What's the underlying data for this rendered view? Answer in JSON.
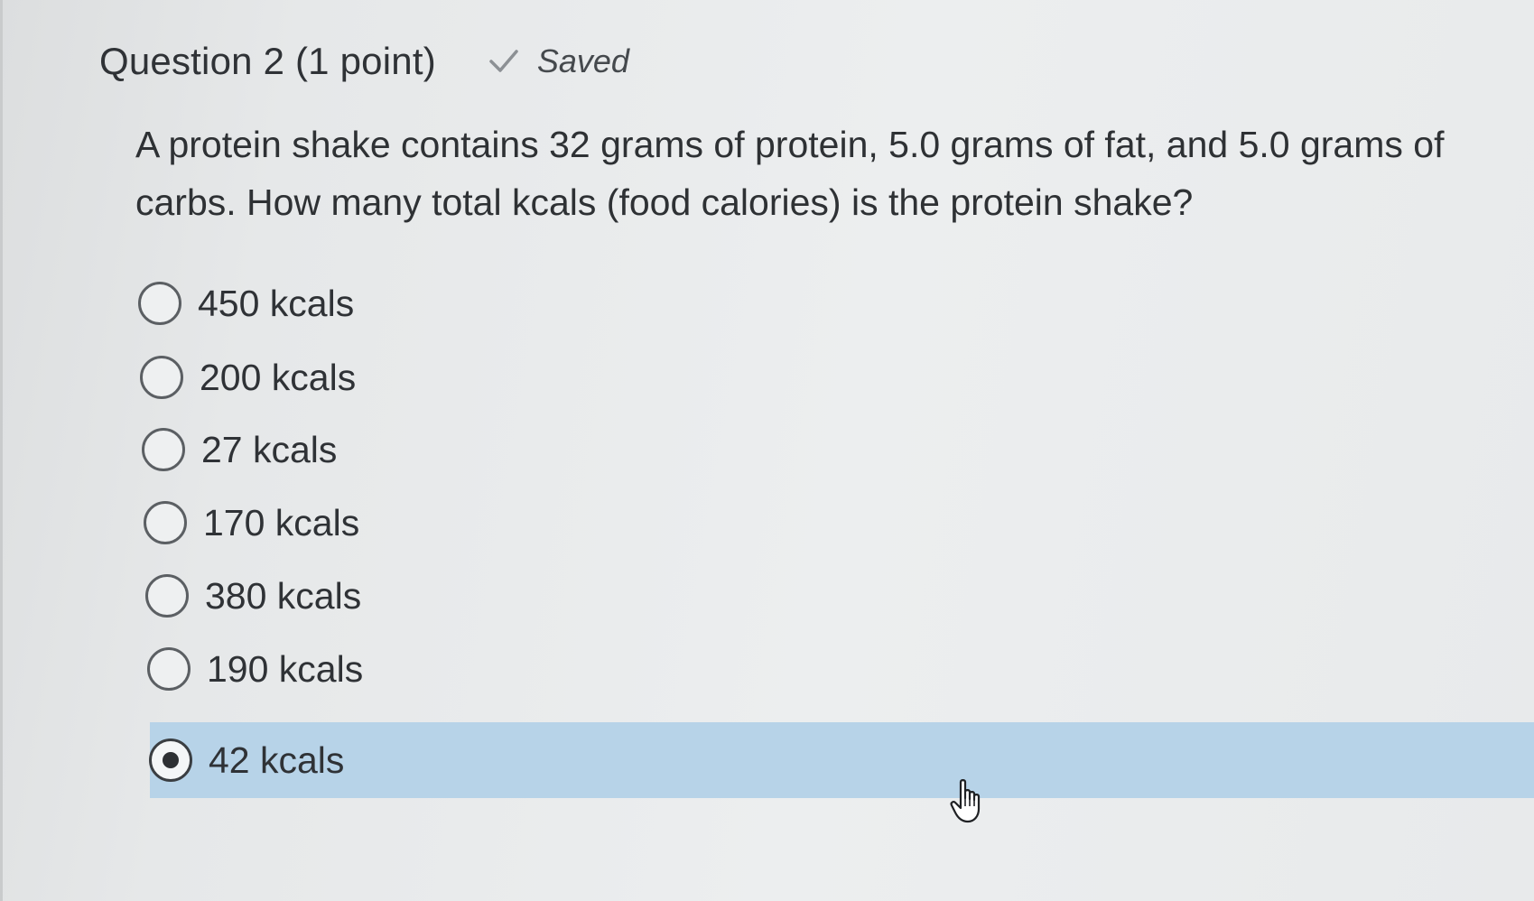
{
  "question": {
    "title": "Question 2 (1 point)",
    "status": "Saved",
    "text": "A protein shake contains 32 grams of protein, 5.0 grams of fat, and 5.0 grams of carbs. How many total kcals (food calories) is the protein shake?"
  },
  "options": [
    {
      "label": "450 kcals",
      "selected": false
    },
    {
      "label": "200 kcals",
      "selected": false
    },
    {
      "label": "27 kcals",
      "selected": false
    },
    {
      "label": "170 kcals",
      "selected": false
    },
    {
      "label": "380 kcals",
      "selected": false
    },
    {
      "label": "190 kcals",
      "selected": false
    },
    {
      "label": "42 kcals",
      "selected": true
    }
  ],
  "colors": {
    "selected_highlight": "#b7d3e8",
    "text": "#2f3236",
    "check_icon": "#8c9094"
  },
  "icons": {
    "saved": "check-icon",
    "pointer": "hand-cursor-icon"
  }
}
